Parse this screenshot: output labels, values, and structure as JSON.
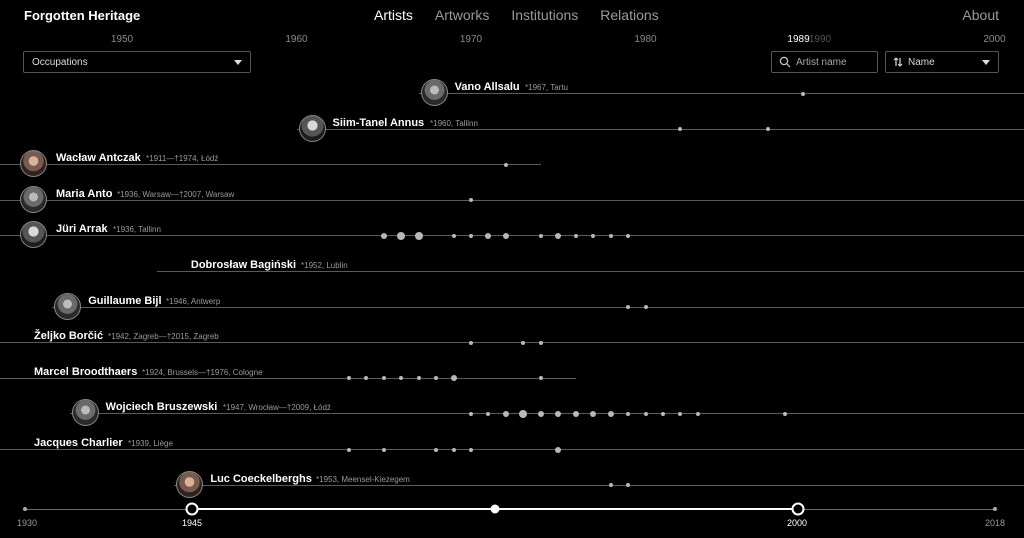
{
  "header": {
    "brand": "Forgotten Heritage",
    "nav": [
      "Artists",
      "Artworks",
      "Institutions",
      "Relations"
    ],
    "about": "About"
  },
  "scale": {
    "ticks": [
      {
        "label": "1950",
        "year": 1950
      },
      {
        "label": "1960",
        "year": 1960
      },
      {
        "label": "1970",
        "year": 1970
      },
      {
        "label": "1980",
        "year": 1980
      },
      {
        "label": "1990",
        "year": 1990
      },
      {
        "label": "2000",
        "year": 2000
      }
    ],
    "hover_label": "1989"
  },
  "filters": {
    "occupations_label": "Occupations",
    "search_placeholder": "Artist name",
    "sort_label": "Name"
  },
  "artists": [
    {
      "name": "Vano Allsalu",
      "meta": "*1967, Tartu",
      "start": 1967,
      "end": 2000,
      "avatar": true,
      "works": [
        [
          1989,
          2
        ]
      ]
    },
    {
      "name": "Siim-Tanel Annus",
      "meta": "*1960, Tallinn",
      "start": 1960,
      "end": 2000,
      "avatar": true,
      "works": [
        [
          1982,
          2
        ],
        [
          1987,
          2
        ]
      ]
    },
    {
      "name": "Wacław Antczak",
      "meta": "*1911—†1974, Łódź",
      "start": 1911,
      "end": 1974,
      "avatar": true,
      "works": [
        [
          1972,
          2
        ]
      ]
    },
    {
      "name": "Maria Anto",
      "meta": "*1936, Warsaw—†2007, Warsaw",
      "start": 1936,
      "end": 2000,
      "avatar": true,
      "works": [
        [
          1970,
          2
        ]
      ]
    },
    {
      "name": "Jüri Arrak",
      "meta": "*1936, Tallinn",
      "start": 1936,
      "end": 2000,
      "avatar": true,
      "works": [
        [
          1965,
          3
        ],
        [
          1966,
          4
        ],
        [
          1967,
          4
        ],
        [
          1969,
          2
        ],
        [
          1970,
          2
        ],
        [
          1971,
          3
        ],
        [
          1972,
          3
        ],
        [
          1974,
          2
        ],
        [
          1975,
          3
        ],
        [
          1976,
          2
        ],
        [
          1977,
          2
        ],
        [
          1978,
          2
        ],
        [
          1979,
          2
        ]
      ]
    },
    {
      "name": "Dobrosław Bagiński",
      "meta": "*1952, Lublin",
      "start": 1952,
      "end": 2000,
      "avatar": false,
      "works": []
    },
    {
      "name": "Guillaume Bijl",
      "meta": "*1946, Antwerp",
      "start": 1946,
      "end": 2000,
      "avatar": true,
      "works": [
        [
          1979,
          2
        ],
        [
          1980,
          2
        ]
      ]
    },
    {
      "name": "Željko Borčić",
      "meta": "*1942, Zagreb—†2015, Zagreb",
      "start": 1942,
      "end": 2000,
      "avatar": false,
      "works": [
        [
          1970,
          2
        ],
        [
          1973,
          2
        ],
        [
          1974,
          2
        ]
      ]
    },
    {
      "name": "Marcel Broodthaers",
      "meta": "*1924, Brussels—†1976, Cologne",
      "start": 1924,
      "end": 1976,
      "avatar": false,
      "works": [
        [
          1963,
          2
        ],
        [
          1964,
          2
        ],
        [
          1965,
          2
        ],
        [
          1966,
          2
        ],
        [
          1967,
          2
        ],
        [
          1968,
          2
        ],
        [
          1969,
          3
        ],
        [
          1974,
          2
        ]
      ]
    },
    {
      "name": "Wojciech Bruszewski",
      "meta": "*1947, Wrocław—†2009, Łódź",
      "start": 1947,
      "end": 2000,
      "avatar": true,
      "works": [
        [
          1970,
          2
        ],
        [
          1971,
          2
        ],
        [
          1972,
          3
        ],
        [
          1973,
          4
        ],
        [
          1974,
          3
        ],
        [
          1975,
          3
        ],
        [
          1976,
          3
        ],
        [
          1977,
          3
        ],
        [
          1978,
          3
        ],
        [
          1979,
          2
        ],
        [
          1980,
          2
        ],
        [
          1981,
          2
        ],
        [
          1982,
          2
        ],
        [
          1983,
          2
        ],
        [
          1988,
          2
        ]
      ]
    },
    {
      "name": "Jacques Charlier",
      "meta": "*1939, Liège",
      "start": 1939,
      "end": 2000,
      "avatar": false,
      "works": [
        [
          1963,
          2
        ],
        [
          1965,
          2
        ],
        [
          1968,
          2
        ],
        [
          1969,
          2
        ],
        [
          1970,
          2
        ],
        [
          1975,
          3
        ]
      ]
    },
    {
      "name": "Luc Coeckelberghs",
      "meta": "*1953, Meensel-Kiezegem",
      "start": 1953,
      "end": 2000,
      "avatar": true,
      "works": [
        [
          1978,
          2
        ],
        [
          1979,
          2
        ]
      ]
    }
  ],
  "timeline": {
    "range_start_label": "1930",
    "range_end_label": "2018",
    "selected_start_label": "1945",
    "selected_end_label": "2000"
  }
}
